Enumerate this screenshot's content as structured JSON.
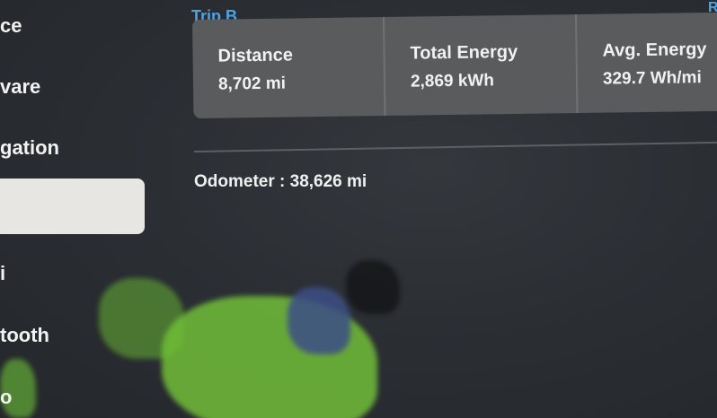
{
  "sidebar": {
    "items": [
      {
        "label": "ce"
      },
      {
        "label": "vare"
      },
      {
        "label": "gation"
      },
      {
        "label": ""
      },
      {
        "label": "i"
      },
      {
        "label": "tooth"
      },
      {
        "label": "o"
      }
    ]
  },
  "trip": {
    "title": "Trip B",
    "corner_text": "R",
    "stats": [
      {
        "label": "Distance",
        "value": "8,702 mi"
      },
      {
        "label": "Total Energy",
        "value": "2,869 kWh"
      },
      {
        "label": "Avg. Energy",
        "value": "329.7 Wh/mi"
      }
    ]
  },
  "odometer": {
    "text": "Odometer : 38,626 mi"
  },
  "colors": {
    "accent": "#4fa3e0",
    "card": "#5a5b5d",
    "background": "#2a2e33",
    "selected_item": "#e8e6e2"
  }
}
